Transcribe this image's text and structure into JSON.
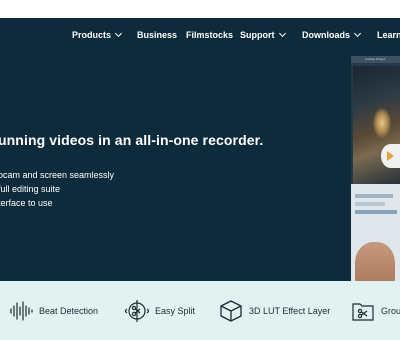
{
  "nav": {
    "items": [
      {
        "label": "Products",
        "dropdown": true
      },
      {
        "label": "Business",
        "dropdown": false
      },
      {
        "label": "Filmstocks",
        "dropdown": false
      },
      {
        "label": "Support",
        "dropdown": true
      },
      {
        "label": "Downloads",
        "dropdown": true
      },
      {
        "label": "Learn",
        "dropdown": false
      }
    ]
  },
  "hero": {
    "headline": "unning videos in an all-in-one recorder.",
    "bullets": [
      "bcam and screen seamlessly",
      "full editing suite",
      "terface to use"
    ],
    "screenshot_title": "Untitled Project"
  },
  "features": [
    {
      "label": "Beat Detection",
      "icon": "audio-wave-icon"
    },
    {
      "label": "Easy Split",
      "icon": "split-icon"
    },
    {
      "label": "3D LUT Effect Layer",
      "icon": "cube-icon"
    },
    {
      "label": "Grou",
      "icon": "group-folder-icon"
    }
  ],
  "colors": {
    "hero_background": "#0e2b3c",
    "feature_background": "#e2f2f1",
    "text_light": "#ffffff",
    "text_dark": "#1c2a36"
  }
}
